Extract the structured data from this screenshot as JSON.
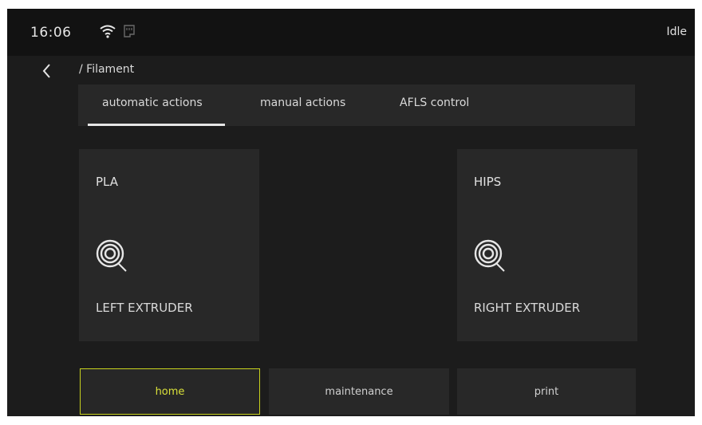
{
  "status": {
    "time": "16:06",
    "state": "Idle",
    "icons": [
      "wifi-icon",
      "sd-card-icon"
    ]
  },
  "header": {
    "back_icon": "chevron-left-icon",
    "breadcrumb": "/ Filament"
  },
  "tabs": [
    {
      "label": "automatic actions",
      "active": true
    },
    {
      "label": "manual actions",
      "active": false
    },
    {
      "label": "AFLS control",
      "active": false
    }
  ],
  "extruders": [
    {
      "material": "PLA",
      "label": "LEFT EXTRUDER",
      "icon": "filament-spool-icon"
    },
    {
      "material": "HIPS",
      "label": "RIGHT EXTRUDER",
      "icon": "filament-spool-icon"
    }
  ],
  "nav": [
    {
      "label": "home",
      "active": true
    },
    {
      "label": "maintenance",
      "active": false
    },
    {
      "label": "print",
      "active": false
    }
  ],
  "colors": {
    "background": "#1c1c1c",
    "panel": "#282828",
    "accent": "#c8d21e",
    "text": "#d9d9d9"
  }
}
